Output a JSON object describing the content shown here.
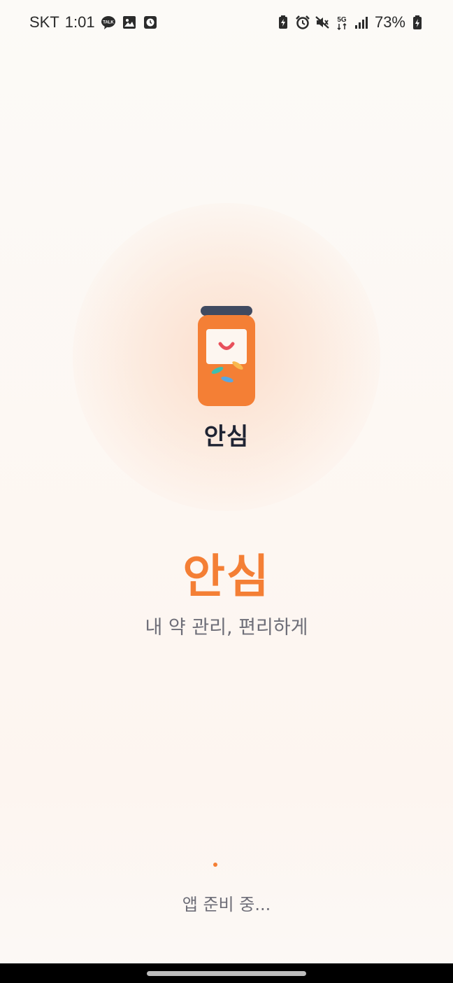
{
  "status_bar": {
    "carrier": "SKT",
    "time": "1:01",
    "left_icons": [
      "kakaotalk-icon",
      "gallery-icon",
      "clock-app-icon"
    ],
    "talk_badge": "TALK",
    "right_icons": [
      "battery-saver-icon",
      "alarm-icon",
      "mute-icon",
      "5g-icon",
      "signal-icon"
    ],
    "network": "5G",
    "battery": "73%"
  },
  "splash": {
    "icon_caption": "안심",
    "title": "안심",
    "tagline": "내 약 관리, 편리하게",
    "loading": "앱 준비 중..."
  },
  "colors": {
    "accent": "#f47f35",
    "jar_lid": "#404a60",
    "heart": "#e8505b",
    "text_dark": "#1f2433",
    "text_muted": "#6e6e78"
  }
}
